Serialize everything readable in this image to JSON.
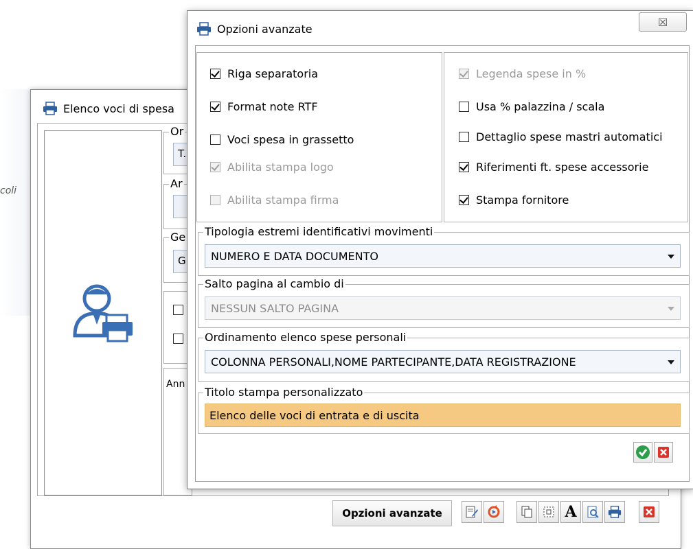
{
  "background": {
    "partial_label": "coli"
  },
  "back_window": {
    "title": "Elenco voci di spesa",
    "groups": [
      {
        "label": "Or",
        "value": "T."
      },
      {
        "label": "Ar",
        "value": ""
      },
      {
        "label": "Ge",
        "value": "G"
      }
    ],
    "notes_label": "Ann",
    "opzioni_button": "Opzioni avanzate",
    "toolbar": [
      "edit-icon",
      "refresh-icon",
      "copy-icon",
      "select-icon",
      "font-icon",
      "preview-icon",
      "print-icon",
      "close-icon"
    ]
  },
  "dialog": {
    "title": "Opzioni avanzate",
    "close_glyph": "☒",
    "left_options": [
      {
        "label": "Riga separatoria",
        "checked": true,
        "enabled": true
      },
      {
        "label": "Format note RTF",
        "checked": true,
        "enabled": true
      },
      {
        "label": "Voci spesa in grassetto",
        "checked": false,
        "enabled": true
      },
      {
        "label": "Abilita stampa logo",
        "checked": true,
        "enabled": false
      },
      {
        "label": "Abilita stampa firma",
        "checked": false,
        "enabled": false
      }
    ],
    "right_options": [
      {
        "label": "Legenda spese in %",
        "checked": true,
        "enabled": false
      },
      {
        "label": "Usa % palazzina / scala",
        "checked": false,
        "enabled": true
      },
      {
        "label": "Dettaglio spese mastri automatici",
        "checked": false,
        "enabled": true
      },
      {
        "label": "Riferimenti ft. spese accessorie",
        "checked": true,
        "enabled": true
      },
      {
        "label": "Stampa fornitore",
        "checked": true,
        "enabled": true
      }
    ],
    "tipologia": {
      "label": "Tipologia estremi identificativi movimenti",
      "value": "NUMERO E DATA DOCUMENTO"
    },
    "salto": {
      "label": "Salto pagina al cambio di",
      "value": "NESSUN SALTO PAGINA"
    },
    "ordinamento": {
      "label": "Ordinamento elenco spese personali",
      "value": "COLONNA PERSONALI,NOME PARTECIPANTE,DATA REGISTRAZIONE"
    },
    "titolo": {
      "label": "Titolo stampa personalizzato",
      "value": "Elenco delle voci di entrata e di uscita"
    }
  },
  "colors": {
    "accent": "#3a6fb5",
    "title_field_bg": "#f5c982",
    "ok_green": "#2e9d4b",
    "cancel_red": "#d9342b"
  }
}
